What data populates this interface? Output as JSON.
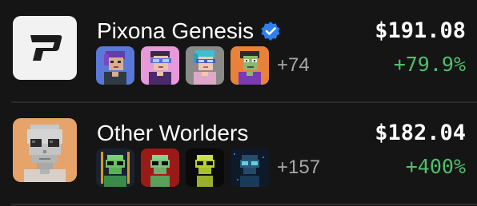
{
  "collections": [
    {
      "name": "Pixona Genesis",
      "verified": true,
      "logo_icon": "pixona-p-logo-icon",
      "thumbnails": [
        {
          "icon": "pixel-avatar-blue-hair-icon",
          "bg": "#5a78d8"
        },
        {
          "icon": "pixel-avatar-goggles-pink-icon",
          "bg": "#e69ad8"
        },
        {
          "icon": "pixel-avatar-cyan-hair-icon",
          "bg": "#8a8a8a"
        },
        {
          "icon": "pixel-avatar-green-zombie-icon",
          "bg": "#e8823a"
        }
      ],
      "more_count": "+74",
      "price": "$191.08",
      "change": "+79.9%"
    },
    {
      "name": "Other Worlders",
      "verified": false,
      "logo_icon": "alien-portrait-logo-icon",
      "thumbnails": [
        {
          "icon": "pixel-alien-green-icon",
          "bg": "#1a2230"
        },
        {
          "icon": "pixel-alien-red-bg-icon",
          "bg": "#9a1a1a"
        },
        {
          "icon": "pixel-alien-yellow-icon",
          "bg": "#0a0a0a"
        },
        {
          "icon": "pixel-alien-ghost-icon",
          "bg": "#0e1a2a"
        }
      ],
      "more_count": "+157",
      "price": "$182.04",
      "change": "+400%"
    }
  ],
  "colors": {
    "background": "#151515",
    "positive": "#4fbf6a",
    "muted_text": "#a8a8a8",
    "verified_badge": "#2f80ed",
    "divider": "#2b2b2b"
  }
}
